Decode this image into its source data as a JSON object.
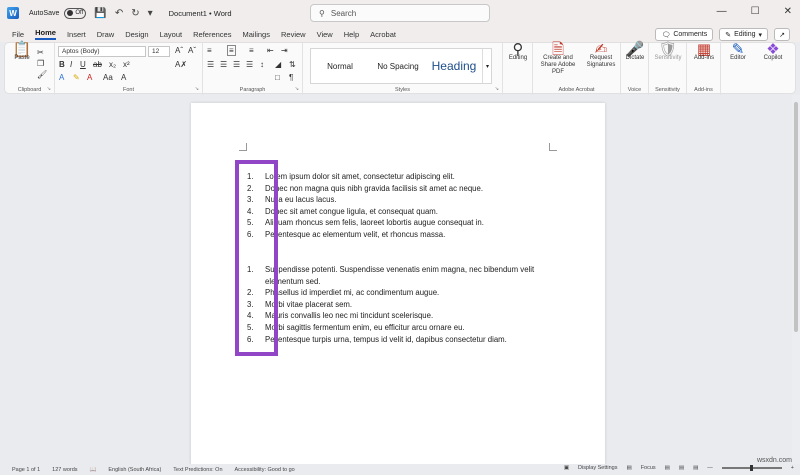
{
  "titlebar": {
    "autosave_label": "AutoSave",
    "autosave_state": "Off",
    "doc_title": "Document1  •  Word",
    "search_placeholder": "Search"
  },
  "menu": {
    "tabs": [
      "File",
      "Home",
      "Insert",
      "Draw",
      "Design",
      "Layout",
      "References",
      "Mailings",
      "Review",
      "View",
      "Help",
      "Acrobat"
    ],
    "active": "Home",
    "comments": "Comments",
    "editing": "Editing"
  },
  "ribbon": {
    "clipboard": {
      "label": "Clipboard",
      "paste": "Paste"
    },
    "font": {
      "label": "Font",
      "name": "Aptos (Body)",
      "size": "12"
    },
    "paragraph": {
      "label": "Paragraph"
    },
    "styles": {
      "label": "Styles",
      "items": [
        "Normal",
        "No Spacing",
        "Heading"
      ]
    },
    "editing": {
      "label": "Editing"
    },
    "acrobat": {
      "label": "Adobe Acrobat",
      "create": "Create and Share Adobe PDF",
      "request": "Request Signatures"
    },
    "voice": {
      "label": "Voice",
      "dictate": "Dictate"
    },
    "sensitivity": {
      "label": "Sensitivity",
      "btn": "Sensitivity"
    },
    "addins": {
      "label": "Add-ins",
      "btn": "Add-ins"
    },
    "editor": "Editor",
    "copilot": "Copilot"
  },
  "document": {
    "list1": [
      "Lorem ipsum dolor sit amet, consectetur adipiscing elit.",
      "Donec non magna quis nibh gravida facilisis sit amet ac neque.",
      "Nulla eu lacus lacus.",
      "Donec sit amet congue ligula, et consequat quam.",
      "Aliquam rhoncus sem felis, laoreet lobortis augue consequat in.",
      "Pellentesque ac elementum velit, et rhoncus massa."
    ],
    "list2": [
      "Suspendisse potenti. Suspendisse venenatis enim magna, nec bibendum velit elementum sed.",
      "Phasellus id imperdiet mi, ac condimentum augue.",
      "Morbi vitae placerat sem.",
      "Mauris convallis leo nec mi tincidunt scelerisque.",
      "Morbi sagittis fermentum enim, eu efficitur arcu ornare eu.",
      "Pellentesque turpis urna, tempus id velit id, dapibus consectetur diam."
    ]
  },
  "status": {
    "page": "Page 1 of 1",
    "words": "127 words",
    "language": "English (South Africa)",
    "predictions": "Text Predictions: On",
    "accessibility": "Accessibility: Good to go",
    "display": "Display Settings",
    "focus": "Focus"
  },
  "watermark": "wsxdn.com",
  "colors": {
    "accent": "#185abd",
    "highlight": "#9146c8"
  }
}
